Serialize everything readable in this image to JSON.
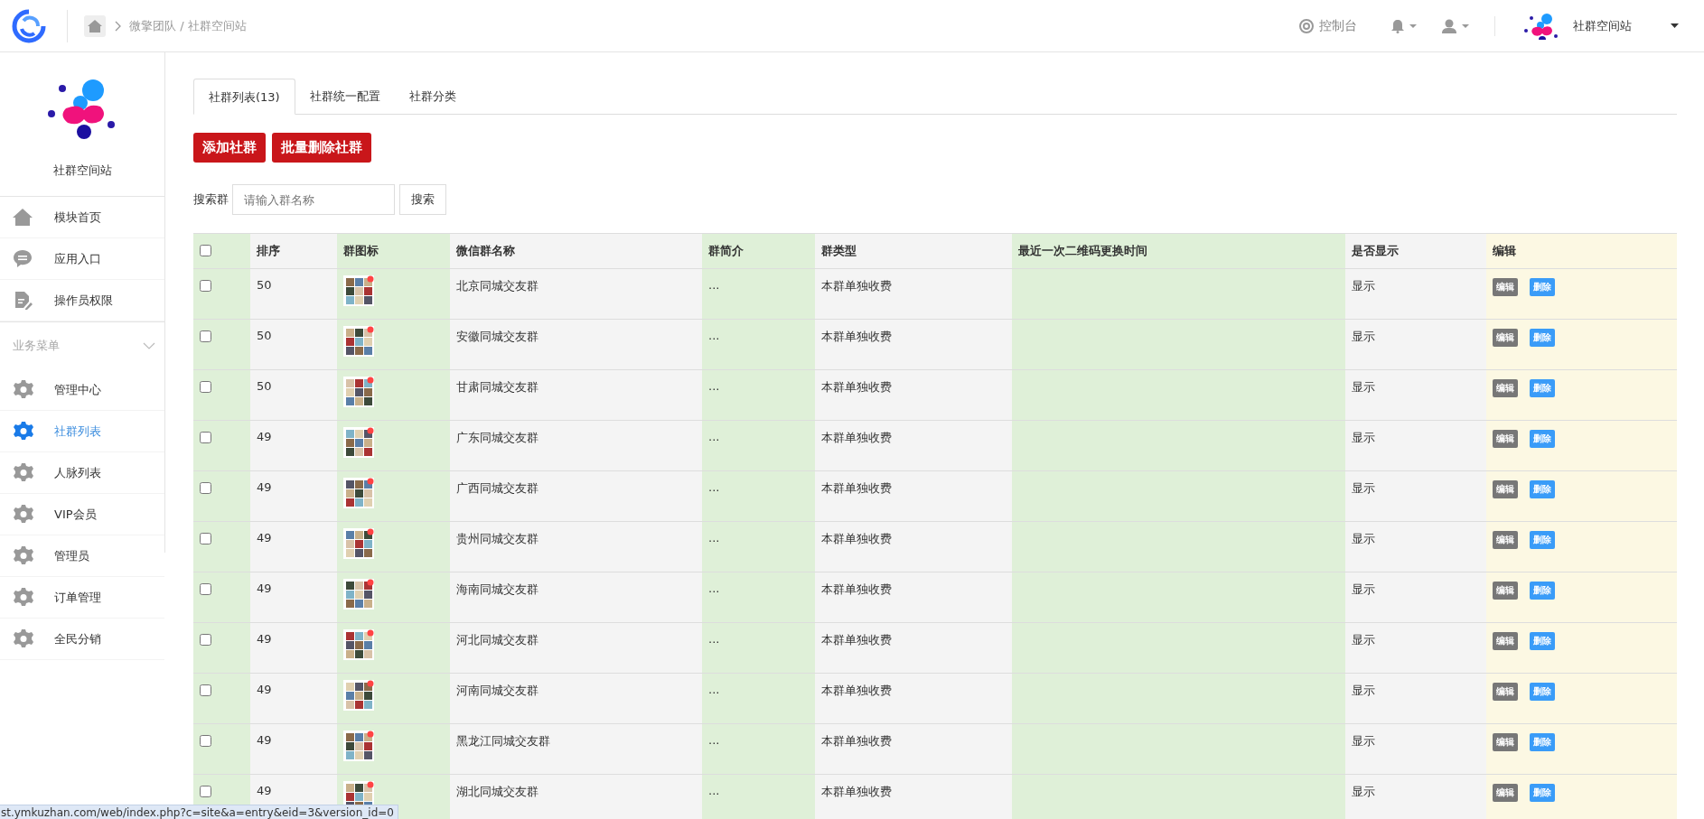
{
  "header": {
    "breadcrumb": "微擎团队 / 社群空间站",
    "console": "控制台",
    "site_name": "社群空间站"
  },
  "sidebar": {
    "site_name": "社群空间站",
    "items": [
      {
        "kind": "home",
        "label": "模块首页",
        "selected": false
      },
      {
        "kind": "chat",
        "label": "应用入口",
        "selected": false
      },
      {
        "kind": "doc",
        "label": "操作员权限",
        "selected": false
      },
      {
        "kind": "section",
        "label": "业务菜单",
        "expanded": true
      },
      {
        "kind": "gear",
        "label": "管理中心",
        "selected": false
      },
      {
        "kind": "gear",
        "label": "社群列表",
        "selected": true
      },
      {
        "kind": "gear",
        "label": "人脉列表",
        "selected": false
      },
      {
        "kind": "gear",
        "label": "VIP会员",
        "selected": false
      },
      {
        "kind": "gear",
        "label": "管理员",
        "selected": false
      },
      {
        "kind": "gear",
        "label": "订单管理",
        "selected": false
      },
      {
        "kind": "gear",
        "label": "全民分销",
        "selected": false
      }
    ]
  },
  "tabs": [
    {
      "label": "社群列表(13)",
      "selected": true
    },
    {
      "label": "社群统一配置",
      "selected": false
    },
    {
      "label": "社群分类",
      "selected": false
    }
  ],
  "actions": [
    "添加社群",
    "批量删除社群"
  ],
  "search": {
    "label": "搜索群",
    "placeholder": "请输入群名称",
    "button": "搜索"
  },
  "table": {
    "select_all": {
      "checked": false
    },
    "columns": [
      "排序",
      "群图标",
      "微信群名称",
      "群简介",
      "群类型",
      "最近一次二维码更换时间",
      "是否显示",
      "编辑"
    ],
    "rows": [
      {
        "checked": false,
        "order": "50",
        "icon": {
          "kind": "picture"
        },
        "name": "北京同城交友群",
        "intro": "...",
        "type": "本群单独收费",
        "visible": "显示",
        "buttons": [
          "编辑",
          "删除"
        ]
      },
      {
        "checked": false,
        "order": "50",
        "icon": {
          "kind": "picture"
        },
        "name": "安徽同城交友群",
        "intro": "...",
        "type": "本群单独收费",
        "visible": "显示",
        "buttons": [
          "编辑",
          "删除"
        ]
      },
      {
        "checked": false,
        "order": "50",
        "icon": {
          "kind": "picture"
        },
        "name": "甘肃同城交友群",
        "intro": "...",
        "type": "本群单独收费",
        "visible": "显示",
        "buttons": [
          "编辑",
          "删除"
        ]
      },
      {
        "checked": false,
        "order": "49",
        "icon": {
          "kind": "picture"
        },
        "name": "广东同城交友群",
        "intro": "...",
        "type": "本群单独收费",
        "visible": "显示",
        "buttons": [
          "编辑",
          "删除"
        ]
      },
      {
        "checked": false,
        "order": "49",
        "icon": {
          "kind": "picture"
        },
        "name": "广西同城交友群",
        "intro": "...",
        "type": "本群单独收费",
        "visible": "显示",
        "buttons": [
          "编辑",
          "删除"
        ]
      },
      {
        "checked": false,
        "order": "49",
        "icon": {
          "kind": "picture"
        },
        "name": "贵州同城交友群",
        "intro": "...",
        "type": "本群单独收费",
        "visible": "显示",
        "buttons": [
          "编辑",
          "删除"
        ]
      },
      {
        "checked": false,
        "order": "49",
        "icon": {
          "kind": "picture"
        },
        "name": "海南同城交友群",
        "intro": "...",
        "type": "本群单独收费",
        "visible": "显示",
        "buttons": [
          "编辑",
          "删除"
        ]
      },
      {
        "checked": false,
        "order": "49",
        "icon": {
          "kind": "picture"
        },
        "name": "河北同城交友群",
        "intro": "...",
        "type": "本群单独收费",
        "visible": "显示",
        "buttons": [
          "编辑",
          "删除"
        ]
      },
      {
        "checked": false,
        "order": "49",
        "icon": {
          "kind": "picture"
        },
        "name": "河南同城交友群",
        "intro": "...",
        "type": "本群单独收费",
        "visible": "显示",
        "buttons": [
          "编辑",
          "删除"
        ]
      },
      {
        "checked": false,
        "order": "49",
        "icon": {
          "kind": "picture"
        },
        "name": "黑龙江同城交友群",
        "intro": "...",
        "type": "本群单独收费",
        "visible": "显示",
        "buttons": [
          "编辑",
          "删除"
        ]
      },
      {
        "checked": false,
        "order": "49",
        "icon": {
          "kind": "picture"
        },
        "name": "湖北同城交友群",
        "intro": "...",
        "type": "本群单独收费",
        "visible": "显示",
        "buttons": [
          "编辑",
          "删除"
        ]
      }
    ]
  },
  "status_bar": {
    "url": "st.ymkuzhan.com/web/index.php?c=site&a=entry&eid=3&version_id=0"
  }
}
